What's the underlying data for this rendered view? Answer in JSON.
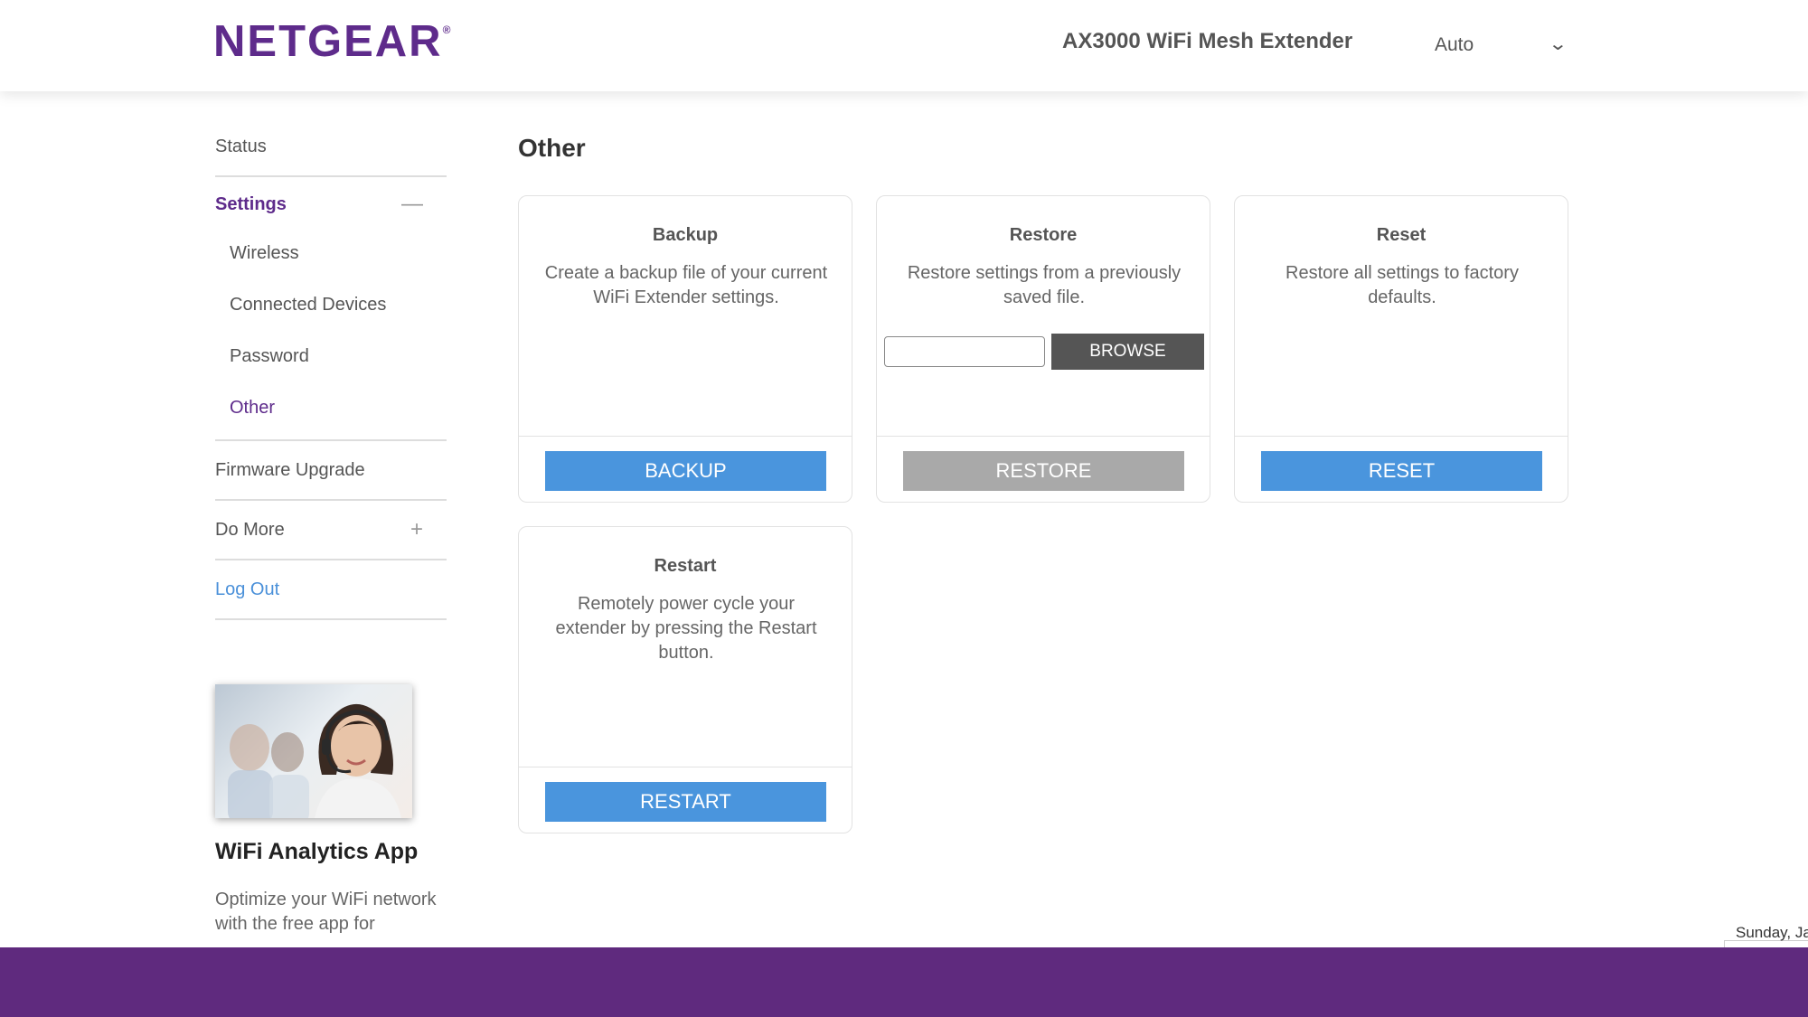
{
  "header": {
    "brand": "NETGEAR",
    "registered_mark": "®",
    "device_title": "AX3000 WiFi Mesh Extender",
    "language": {
      "selected": "Auto"
    }
  },
  "sidebar": {
    "status": "Status",
    "settings": {
      "label": "Settings",
      "sign": "—"
    },
    "sub_items": [
      "Wireless",
      "Connected Devices",
      "Password",
      "Other"
    ],
    "active_sub": "Other",
    "firmware": "Firmware Upgrade",
    "do_more": {
      "label": "Do More",
      "sign": "+"
    },
    "logout": "Log Out"
  },
  "promo": {
    "title": "WiFi Analytics App",
    "text": "Optimize your WiFi network with the free app for"
  },
  "main": {
    "title": "Other",
    "cards": {
      "backup": {
        "title": "Backup",
        "description": "Create a backup file of your current WiFi Extender settings.",
        "button": "BACKUP"
      },
      "restore": {
        "title": "Restore",
        "description": "Restore settings from a previously saved file.",
        "file_value": "",
        "browse": "BROWSE",
        "button": "RESTORE"
      },
      "reset": {
        "title": "Reset",
        "description": "Restore all settings to factory defaults.",
        "button": "RESET"
      },
      "restart": {
        "title": "Restart",
        "description": "Remotely power cycle your extender by pressing the Restart button.",
        "button": "RESTART"
      }
    }
  },
  "footer": {
    "date_fragment": "Sunday, Ja"
  },
  "colors": {
    "brand_purple": "#5e2b8b",
    "footer_purple": "#5f2a7e",
    "button_blue": "#4a95dd",
    "button_disabled": "#a9a9a9",
    "link_blue": "#4a90d9"
  }
}
